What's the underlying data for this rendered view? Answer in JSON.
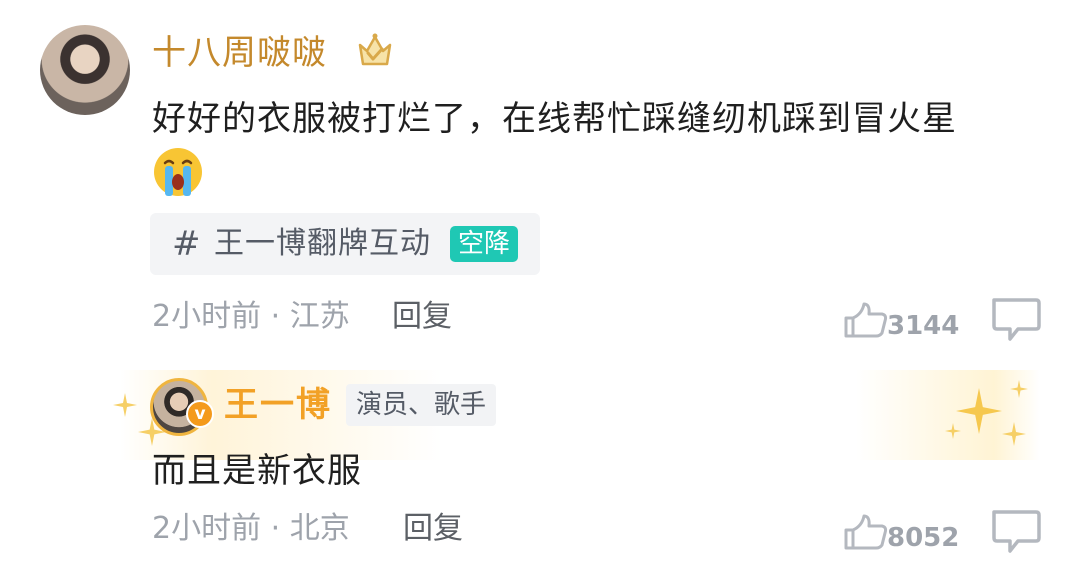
{
  "comment": {
    "username": "十八周啵啵",
    "text": "好好的衣服被打烂了，在线帮忙踩缝纫机踩到冒火星",
    "topic": {
      "hash": "#",
      "label": "王一博翻牌互动",
      "badge": "空降"
    },
    "meta": "2小时前 · 江苏",
    "reply_label": "回复",
    "like_count": "3144",
    "icons": {
      "badge": "crown-icon",
      "emoji": "crying-face-emoji",
      "like": "thumbs-up-icon",
      "reply": "comment-bubble-icon"
    }
  },
  "reply": {
    "username": "王一博",
    "verified_badge": "v",
    "role_tag": "演员、歌手",
    "text": "而且是新衣服",
    "meta": "2小时前 · 北京",
    "reply_label": "回复",
    "like_count": "8052",
    "icons": {
      "decoration": "sparkle-icon",
      "like": "thumbs-up-icon",
      "reply": "comment-bubble-icon"
    }
  },
  "colors": {
    "username_gold": "#c4892c",
    "vip_orange": "#f2a126",
    "topic_badge": "#1fc8b4",
    "meta_gray": "#9ea3ab"
  }
}
